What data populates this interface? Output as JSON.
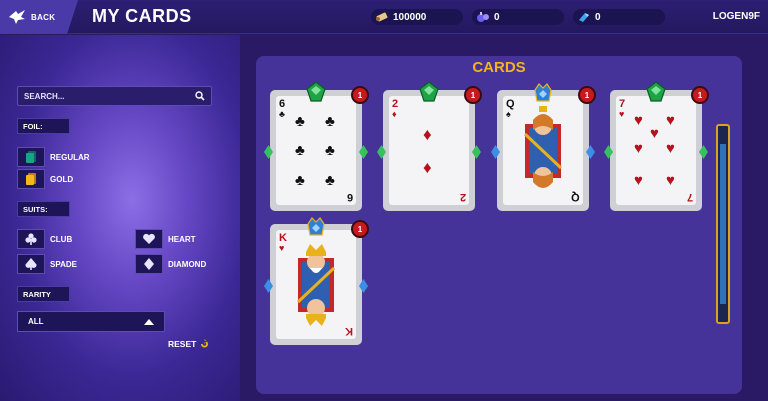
{
  "header": {
    "back_label": "BACK",
    "title": "MY CARDS",
    "username": "LOGEN9F",
    "currencies": [
      {
        "icon": "scroll-icon",
        "value": "100000"
      },
      {
        "icon": "potion-icon",
        "value": "0"
      },
      {
        "icon": "crystal-icon",
        "value": "0"
      }
    ]
  },
  "sidebar": {
    "search_placeholder": "SEARCH...",
    "foil_label": "FOIL:",
    "foil_options": [
      {
        "label": "REGULAR",
        "icon": "regular-foil-icon",
        "color": "#17a58a"
      },
      {
        "label": "GOLD",
        "icon": "gold-foil-icon",
        "color": "#f2b81c"
      }
    ],
    "suits_label": "SUITS:",
    "suits": [
      {
        "label": "CLUB",
        "icon": "club-icon"
      },
      {
        "label": "HEART",
        "icon": "heart-icon"
      },
      {
        "label": "SPADE",
        "icon": "spade-icon"
      },
      {
        "label": "DIAMOND",
        "icon": "diamond-icon"
      }
    ],
    "rarity_label": "RARITY",
    "rarity_value": "ALL",
    "reset_label": "RESET"
  },
  "panel": {
    "title": "CARDS",
    "cards": [
      {
        "rank": "6",
        "suit": "club",
        "count": "1",
        "gem": "green"
      },
      {
        "rank": "2",
        "suit": "diamond",
        "count": "1",
        "gem": "green"
      },
      {
        "rank": "Q",
        "suit": "spade",
        "count": "1",
        "gem": "blue"
      },
      {
        "rank": "7",
        "suit": "heart",
        "count": "1",
        "gem": "green"
      },
      {
        "rank": "K",
        "suit": "heart",
        "count": "1",
        "gem": "blue"
      }
    ]
  },
  "colors": {
    "accent_gold": "#f5b21a",
    "badge_red": "#c8191f",
    "panel": "#45339a",
    "gem_green": "#20a247",
    "gem_blue": "#2f7fd6"
  }
}
